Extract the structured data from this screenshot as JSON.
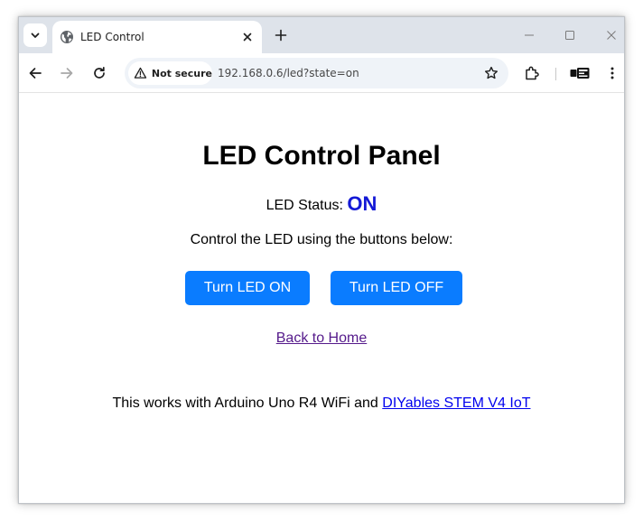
{
  "browser": {
    "tab": {
      "title": "LED Control",
      "favicon": "globe-icon"
    },
    "toolbar": {
      "security_label": "Not secure",
      "url": "192.168.0.6/led?state=on"
    },
    "extension": {
      "name": "diyables-logo",
      "logo_text": "DIY"
    }
  },
  "page": {
    "title": "LED Control Panel",
    "status_label": "LED Status:",
    "status_value": "ON",
    "instruction": "Control the LED using the buttons below:",
    "buttons": {
      "on_label": "Turn LED ON",
      "off_label": "Turn LED OFF"
    },
    "home_link": "Back to Home",
    "footer_text": "This works with Arduino Uno R4 WiFi and ",
    "footer_link": "DIYables STEM V4 IoT"
  },
  "colors": {
    "button": "#0a7cff",
    "status_value": "#1419d6",
    "visited_link": "#551a8b",
    "link": "#0000ee",
    "tab_strip": "#dee3ea"
  }
}
